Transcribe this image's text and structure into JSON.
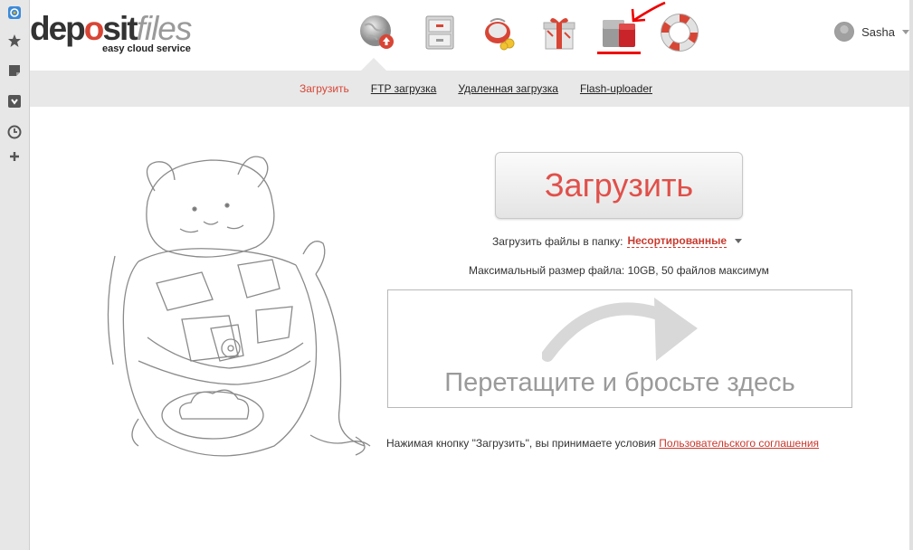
{
  "logo": {
    "part1": "dep",
    "part2": "o",
    "part3": "sit",
    "part4": "files",
    "tagline": "easy cloud service"
  },
  "header": {
    "user_name": "Sasha",
    "nav_icons": [
      "upload-globe-icon",
      "file-cabinet-icon",
      "piggy-bank-icon",
      "gift-icon",
      "storage-server-icon",
      "lifebuoy-icon"
    ]
  },
  "subnav": {
    "items": [
      {
        "label": "Загрузить",
        "active": true
      },
      {
        "label": "FTP загрузка",
        "active": false
      },
      {
        "label": "Удаленная загрузка",
        "active": false
      },
      {
        "label": "Flash-uploader",
        "active": false
      }
    ]
  },
  "main": {
    "upload_button": "Загрузить",
    "folder_label": "Загрузить файлы в папку:",
    "folder_value": "Несортированные",
    "max_size_text": "Максимальный размер файла: 10GB, 50 файлов максимум",
    "dropzone_text": "Перетащите и бросьте здесь",
    "terms_text": "Нажимая кнопку \"Загрузить\", вы принимаете условия",
    "terms_link": "Пользовательского соглашения"
  },
  "colors": {
    "accent": "#d84535",
    "annotation": "#e00000"
  }
}
